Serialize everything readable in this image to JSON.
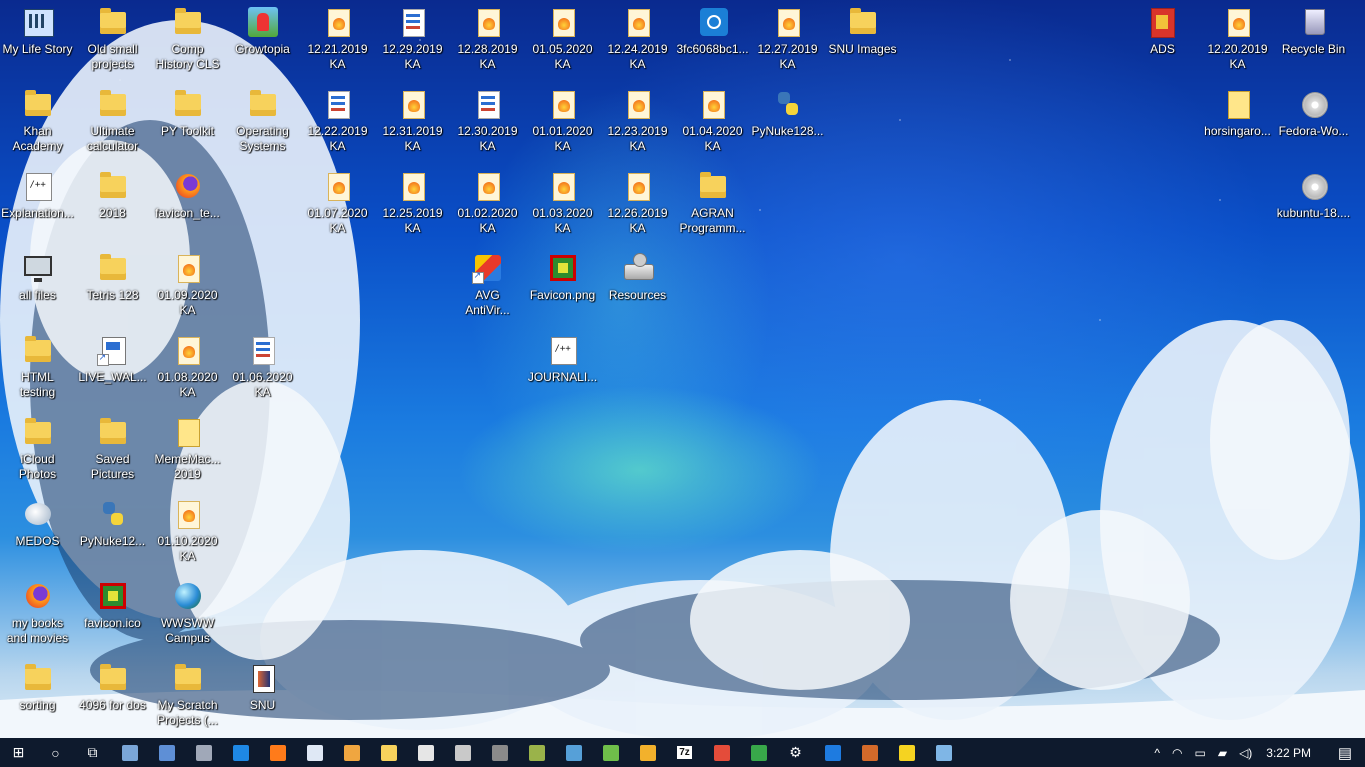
{
  "desktop": {
    "icons": [
      {
        "label": "My Life Story",
        "icon": "msicon"
      },
      {
        "label": "Old small\nprojects",
        "icon": "folder"
      },
      {
        "label": "Comp\nHistory CLS",
        "icon": "folder"
      },
      {
        "label": "Growtopia",
        "icon": "growtopia"
      },
      {
        "label": "12.21.2019\nKA",
        "icon": "docfire"
      },
      {
        "label": "12.29.2019\nKA",
        "icon": "docstack"
      },
      {
        "label": "12.28.2019\nKA",
        "icon": "docfire"
      },
      {
        "label": "01.05.2020\nKA",
        "icon": "docfire"
      },
      {
        "label": "12.24.2019\nKA",
        "icon": "docfire"
      },
      {
        "label": "3fc6068bc1...",
        "icon": "insta"
      },
      {
        "label": "12.27.2019\nKA",
        "icon": "docfire"
      },
      {
        "label": "SNU Images",
        "icon": "folder"
      },
      {
        "label": "ADS",
        "icon": "ads"
      },
      {
        "label": "12.20.2019\nKA",
        "icon": "docfire"
      },
      {
        "label": "Recycle Bin",
        "icon": "binicon"
      },
      {
        "label": "Khan\nAcademy",
        "icon": "folder"
      },
      {
        "label": "Ultimate\ncalculator",
        "icon": "folder"
      },
      {
        "label": "PY Toolkit",
        "icon": "folder"
      },
      {
        "label": "Operating\nSystems",
        "icon": "folder"
      },
      {
        "label": "12.22.2019\nKA",
        "icon": "docstack"
      },
      {
        "label": "12.31.2019\nKA",
        "icon": "docfire"
      },
      {
        "label": "12.30.2019\nKA",
        "icon": "docstack"
      },
      {
        "label": "01.01.2020\nKA",
        "icon": "docfire"
      },
      {
        "label": "12.23.2019\nKA",
        "icon": "docfire"
      },
      {
        "label": "01.04.2020\nKA",
        "icon": "docfire"
      },
      {
        "label": "PyNuke128...",
        "icon": "pyicon"
      },
      {
        "label": "horsingaro...",
        "icon": "yellowdoc"
      },
      {
        "label": "Fedora-Wo...",
        "icon": "disc"
      },
      {
        "label": "Explanation...",
        "icon": "sheet"
      },
      {
        "label": "2018",
        "icon": "folder"
      },
      {
        "label": "favicon_te...",
        "icon": "fox"
      },
      {
        "label": "01.07.2020\nKA",
        "icon": "docfire"
      },
      {
        "label": "12.25.2019\nKA",
        "icon": "docfire"
      },
      {
        "label": "01.02.2020\nKA",
        "icon": "docfire"
      },
      {
        "label": "01.03.2020\nKA",
        "icon": "docfire"
      },
      {
        "label": "12.26.2019\nKA",
        "icon": "docfire"
      },
      {
        "label": "AGRAN\nProgramm...",
        "icon": "folder"
      },
      {
        "label": "kubuntu-18....",
        "icon": "disc"
      },
      {
        "label": "all files",
        "icon": "monitor"
      },
      {
        "label": "Tetris 128",
        "icon": "folder"
      },
      {
        "label": "01.09.2020\nKA",
        "icon": "docfire"
      },
      {
        "label": "AVG\nAntiVir...",
        "icon": "avg"
      },
      {
        "label": "Favicon.png",
        "icon": "greenbox"
      },
      {
        "label": "Resources",
        "icon": "drive"
      },
      {
        "label": "HTML\ntesting",
        "icon": "folder"
      },
      {
        "label": "LIVE_WAL...",
        "icon": "pagemix"
      },
      {
        "label": "01.08.2020\nKA",
        "icon": "docfire"
      },
      {
        "label": "01.06.2020\nKA",
        "icon": "docstack"
      },
      {
        "label": "JOURNALI...",
        "icon": "sheet"
      },
      {
        "label": "iCloud\nPhotos",
        "icon": "folder"
      },
      {
        "label": "Saved\nPictures",
        "icon": "folder"
      },
      {
        "label": "MemeMac...\n2019",
        "icon": "yellowdoc"
      },
      {
        "label": "MEDOS",
        "icon": "cloudicon"
      },
      {
        "label": "PyNuke12...",
        "icon": "pyicon"
      },
      {
        "label": "01.10.2020\nKA",
        "icon": "docfire"
      },
      {
        "label": "my books\nand movies",
        "icon": "fox"
      },
      {
        "label": "favicon.ico",
        "icon": "greenbox"
      },
      {
        "label": "WWSWW\nCampus",
        "icon": "globe"
      },
      {
        "label": "sorting",
        "icon": "folder"
      },
      {
        "label": "4096 for dos",
        "icon": "folder"
      },
      {
        "label": "My Scratch\nProjects (...",
        "icon": "folder"
      },
      {
        "label": "SNU",
        "icon": "snu"
      }
    ]
  },
  "taskbar": {
    "clock": "3:22 PM",
    "apps": [
      {
        "name": "start-button",
        "glyph": "⊞",
        "color": "#ffffff"
      },
      {
        "name": "search-button",
        "glyph": "○",
        "color": "#ffffff"
      },
      {
        "name": "task-view-button",
        "glyph": "⧉",
        "color": "#ffffff"
      },
      {
        "name": "app-computer",
        "glyph": "",
        "color": "#7aa6d8"
      },
      {
        "name": "app-network",
        "glyph": "",
        "color": "#5e8fd6"
      },
      {
        "name": "app-settings-sync",
        "glyph": "",
        "color": "#a0a8b8"
      },
      {
        "name": "app-edge",
        "glyph": "",
        "color": "#1e88e5"
      },
      {
        "name": "app-firefox",
        "glyph": "",
        "color": "#ff7b1a"
      },
      {
        "name": "app-notepad",
        "glyph": "",
        "color": "#dfe8f5"
      },
      {
        "name": "app-docs",
        "glyph": "",
        "color": "#f0a640"
      },
      {
        "name": "app-explorer",
        "glyph": "",
        "color": "#f7d25c"
      },
      {
        "name": "app-messenger",
        "glyph": "",
        "color": "#e6e6e6"
      },
      {
        "name": "app-tools",
        "glyph": "",
        "color": "#c9c9c9"
      },
      {
        "name": "app-game",
        "glyph": "",
        "color": "#8a8a8a"
      },
      {
        "name": "app-pen",
        "glyph": "",
        "color": "#9ab34a"
      },
      {
        "name": "app-terminal",
        "glyph": "",
        "color": "#56a0d8"
      },
      {
        "name": "app-sticky",
        "glyph": "",
        "color": "#6fbf4a"
      },
      {
        "name": "app-files",
        "glyph": "",
        "color": "#f2b12c"
      },
      {
        "name": "app-7zip",
        "glyph": "7z",
        "color": "#222222"
      },
      {
        "name": "app-paint",
        "glyph": "",
        "color": "#e44c3a"
      },
      {
        "name": "app-office",
        "glyph": "",
        "color": "#38a84a"
      },
      {
        "name": "app-gear",
        "glyph": "⚙",
        "color": "#ffffff"
      },
      {
        "name": "app-vs",
        "glyph": "",
        "color": "#1e7be0"
      },
      {
        "name": "app-winrar",
        "glyph": "",
        "color": "#d46a2a"
      },
      {
        "name": "app-stickynotes",
        "glyph": "",
        "color": "#f5d321"
      },
      {
        "name": "app-remote",
        "glyph": "",
        "color": "#7fb6e6"
      }
    ],
    "tray": [
      {
        "name": "tray-chevron-icon",
        "glyph": "^"
      },
      {
        "name": "tray-wifi-icon",
        "glyph": "◠"
      },
      {
        "name": "tray-display-icon",
        "glyph": "▭"
      },
      {
        "name": "tray-battery-icon",
        "glyph": "▰"
      },
      {
        "name": "tray-volume-icon",
        "glyph": "◁)"
      }
    ],
    "notifications_glyph": "▤"
  }
}
